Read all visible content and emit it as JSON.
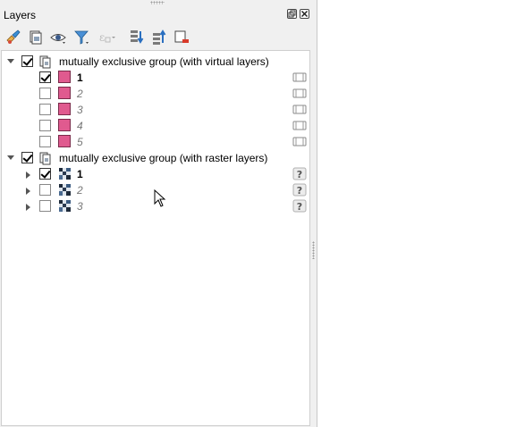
{
  "panel": {
    "title": "Layers"
  },
  "toolbar": {
    "buttons": [
      {
        "icon": "style-brush-icon"
      },
      {
        "icon": "add-group-icon"
      },
      {
        "icon": "visibility-eye-icon"
      },
      {
        "icon": "filter-funnel-icon"
      },
      {
        "icon": "expression-filter-icon"
      },
      {
        "icon": "expand-all-icon"
      },
      {
        "icon": "collapse-all-icon"
      },
      {
        "icon": "remove-layer-icon"
      }
    ]
  },
  "tree": {
    "groups": [
      {
        "label": "mutually exclusive group (with virtual  layers)",
        "checked": true,
        "expanded": true,
        "layers": [
          {
            "label": "1",
            "checked": true,
            "active": true,
            "type": "vector"
          },
          {
            "label": "2",
            "checked": false,
            "active": false,
            "type": "vector"
          },
          {
            "label": "3",
            "checked": false,
            "active": false,
            "type": "vector"
          },
          {
            "label": "4",
            "checked": false,
            "active": false,
            "type": "vector"
          },
          {
            "label": "5",
            "checked": false,
            "active": false,
            "type": "vector"
          }
        ]
      },
      {
        "label": "mutually exclusive group (with raster layers)",
        "checked": true,
        "expanded": true,
        "layers": [
          {
            "label": "1",
            "checked": true,
            "active": true,
            "type": "raster"
          },
          {
            "label": "2",
            "checked": false,
            "active": false,
            "type": "raster"
          },
          {
            "label": "3",
            "checked": false,
            "active": false,
            "type": "raster"
          }
        ]
      }
    ]
  },
  "colors": {
    "vector_swatch": "#e05a8f",
    "panel_bg": "#f0f0f0"
  }
}
